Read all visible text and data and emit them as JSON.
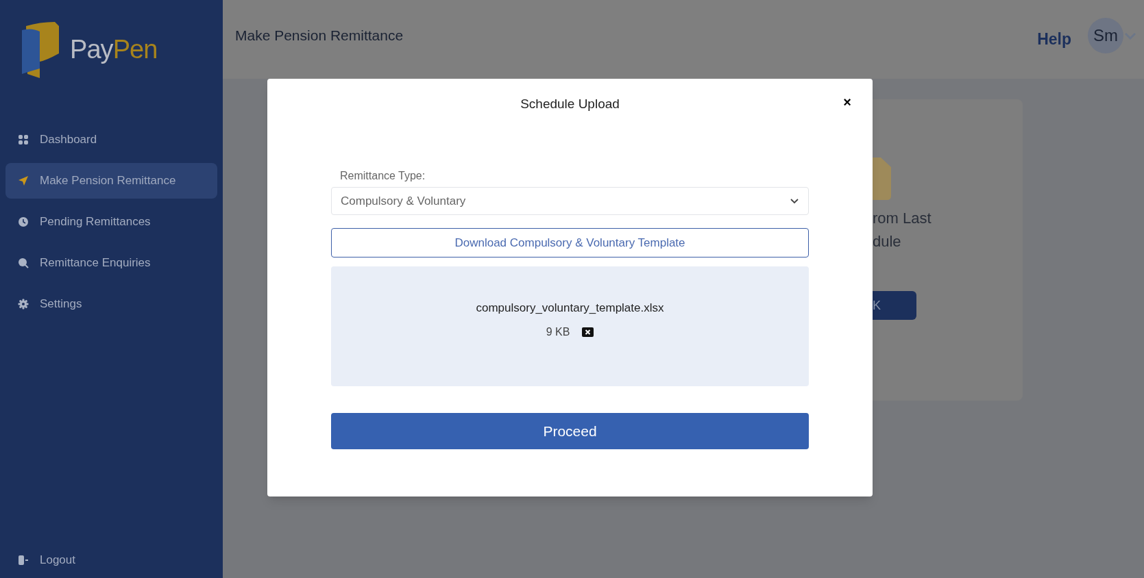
{
  "sidebar": {
    "logo": {
      "part_1": "Pay",
      "part_2": "Pen"
    },
    "items": [
      {
        "kind": "grid",
        "label": "Dashboard",
        "selected": false
      },
      {
        "kind": "plane",
        "label": "Make Pension Remittance",
        "selected": true
      },
      {
        "kind": "clock",
        "label": "Pending Remittances",
        "selected": false
      },
      {
        "kind": "search",
        "label": "Remittance Enquiries",
        "selected": false
      },
      {
        "kind": "gear",
        "label": "Settings",
        "selected": false
      }
    ],
    "logout": "Logout"
  },
  "header": {
    "title": "Make Pension Remittance",
    "help": "Help",
    "avatar": "Sm"
  },
  "background_card": {
    "line_1": "rom Last",
    "line_2": "dule",
    "button": "K"
  },
  "modal": {
    "title": "Schedule Upload",
    "close": "×",
    "field_label": "Remittance Type:",
    "select_value": "Compulsory & Voluntary",
    "download_button": "Download Compulsory & Voluntary Template",
    "file": {
      "name": "compulsory_voluntary_template.xlsx",
      "size": "9 KB"
    },
    "proceed_button": "Proceed"
  }
}
